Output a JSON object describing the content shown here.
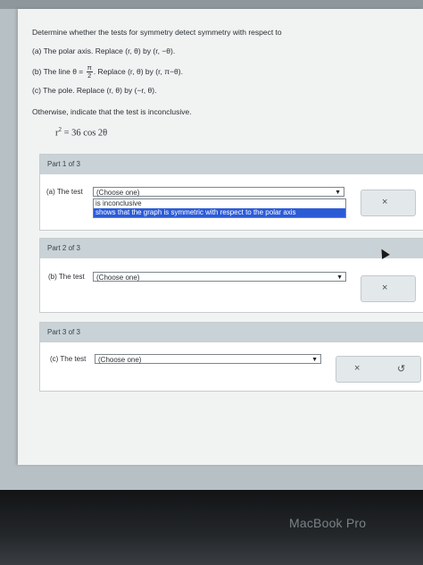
{
  "question": {
    "intro": "Determine whether the tests for symmetry detect symmetry with respect to",
    "line_a": "(a) The polar axis. Replace (r, θ) by (r, −θ).",
    "line_b_prefix": "(b) The line θ =",
    "line_b_frac_num": "π",
    "line_b_frac_den": "2",
    "line_b_suffix": ". Replace (r, θ) by (r, π−θ).",
    "line_c": "(c) The pole. Replace (r, θ) by (−r, θ).",
    "otherwise": "Otherwise, indicate that the test is inconclusive.",
    "eq_lhs": "r",
    "eq_exp": "2",
    "eq_rhs": "= 36 cos 2θ"
  },
  "parts": [
    {
      "header": "Part 1 of 3",
      "label": "(a) The test",
      "select_value": "(Choose one)",
      "options": [
        "is inconclusive",
        "shows that the graph is symmetric with respect to the polar axis"
      ],
      "selected_option": 1,
      "buttons": [
        "×"
      ]
    },
    {
      "header": "Part 2 of 3",
      "label": "(b) The test",
      "select_value": "(Choose one)",
      "buttons": [
        "×"
      ]
    },
    {
      "header": "Part 3 of 3",
      "label": "(c) The test",
      "select_value": "(Choose one)",
      "buttons": [
        "×",
        "↺"
      ]
    }
  ],
  "device": {
    "brand": "MacBook Pro"
  }
}
